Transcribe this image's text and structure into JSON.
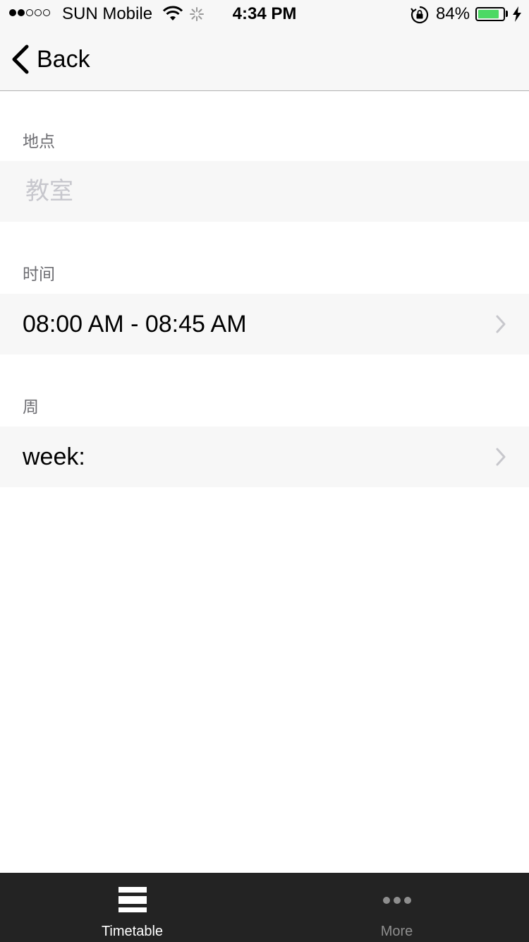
{
  "status_bar": {
    "carrier": "SUN Mobile",
    "signal_bars_filled": 2,
    "signal_bars_total": 5,
    "time": "4:34 PM",
    "battery_percent_label": "84%",
    "battery_level": 0.84,
    "battery_color": "#4cd964"
  },
  "nav": {
    "back_label": "Back"
  },
  "form": {
    "location": {
      "label": "地点",
      "placeholder": "教室",
      "value": ""
    },
    "time": {
      "label": "时间",
      "value": "08:00 AM - 08:45 AM"
    },
    "week": {
      "label": "周",
      "value": "week:"
    }
  },
  "tabbar": {
    "tabs": [
      {
        "label": "Timetable",
        "icon": "timetable-icon",
        "active": true
      },
      {
        "label": "More",
        "icon": "more-dots-icon",
        "active": false
      }
    ]
  }
}
